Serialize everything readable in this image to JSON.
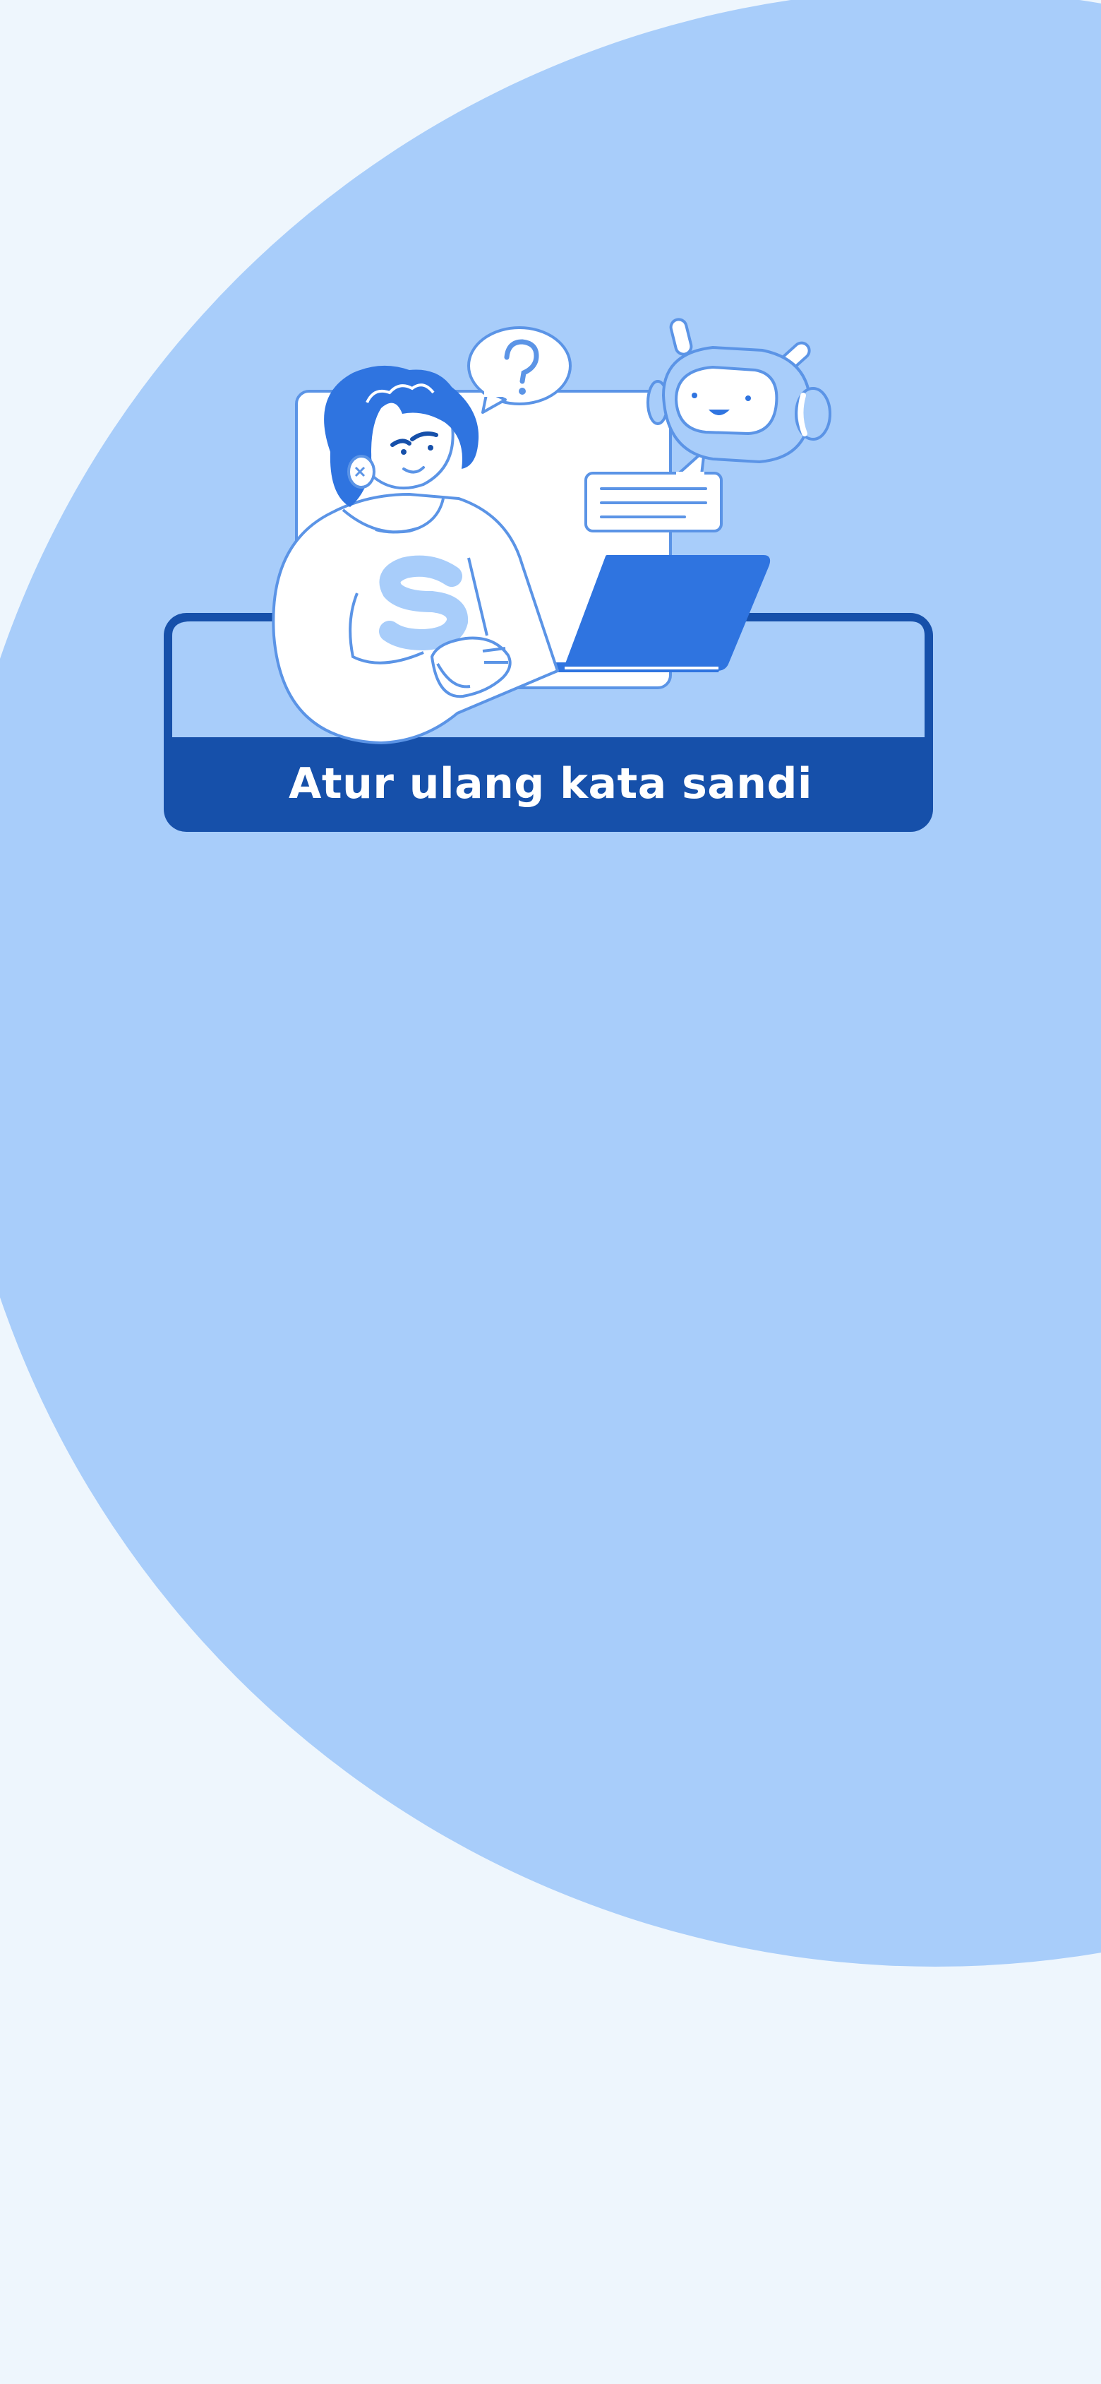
{
  "header": {
    "title": "Atur ulang kata sandi"
  },
  "illustration": {
    "name": "person-with-chatbot-illustration",
    "icons": [
      "question-bubble-icon",
      "chatbot-icon",
      "chat-message-icon",
      "laptop-icon",
      "person-icon"
    ]
  },
  "colors": {
    "background": "#eef6fd",
    "circle": "#a8cdfa",
    "primary": "#1650aa",
    "accent": "#2f74e0",
    "outline": "#5b94e6",
    "white": "#ffffff"
  }
}
